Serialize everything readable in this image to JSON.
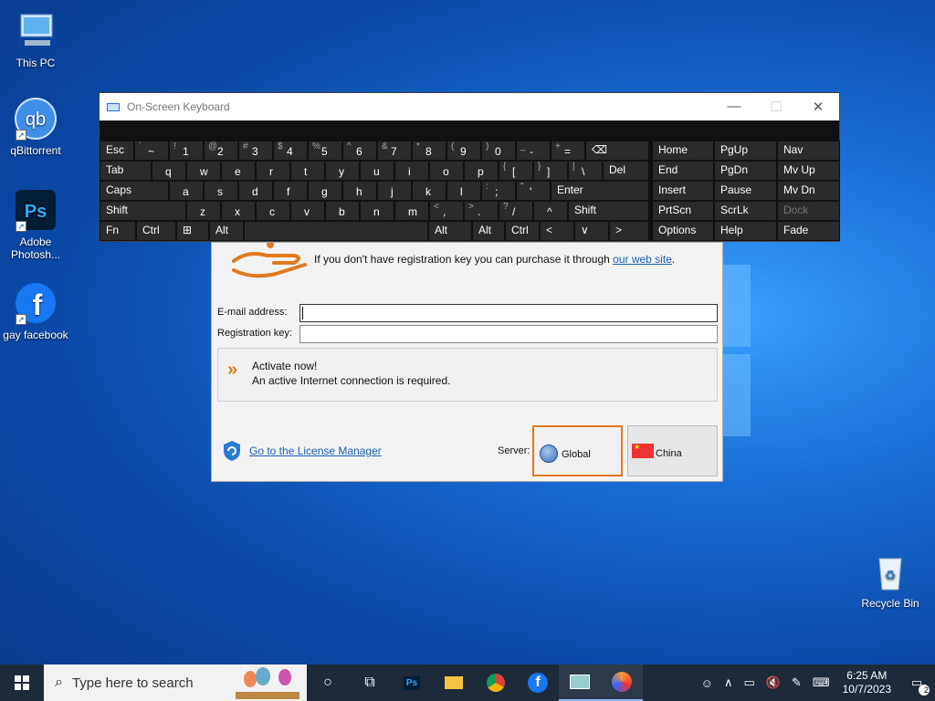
{
  "desktop": {
    "icons": [
      {
        "label": "This PC",
        "icon": "computer-icon"
      },
      {
        "label": "qBittorrent",
        "icon": "qbittorrent-icon"
      },
      {
        "label": "Adobe Photosh...",
        "icon": "photoshop-icon"
      },
      {
        "label": "gay facebook",
        "icon": "facebook-icon"
      },
      {
        "label": "Recycle Bin",
        "icon": "recycle-bin-icon"
      }
    ]
  },
  "osk": {
    "title": "On-Screen Keyboard",
    "controls": {
      "minimize": "—",
      "maximize": "☐",
      "close": "✕"
    },
    "row1": [
      "Esc",
      "~",
      "1",
      "2",
      "3",
      "4",
      "5",
      "6",
      "7",
      "8",
      "9",
      "0",
      "-",
      "=",
      "⌫"
    ],
    "row1_top": [
      "",
      "`",
      "!",
      "@",
      "#",
      "$",
      "%",
      "^",
      "&",
      "*",
      "(",
      ")",
      "_",
      "+",
      ""
    ],
    "row2": [
      "Tab",
      "q",
      "w",
      "e",
      "r",
      "t",
      "y",
      "u",
      "i",
      "o",
      "p",
      "[",
      "]",
      "\\",
      "Del"
    ],
    "row2_top": [
      "",
      "",
      "",
      "",
      "",
      "",
      "",
      "",
      "",
      "",
      "",
      "{",
      "}",
      "|",
      ""
    ],
    "row3": [
      "Caps",
      "a",
      "s",
      "d",
      "f",
      "g",
      "h",
      "j",
      "k",
      "l",
      ";",
      "'",
      "Enter"
    ],
    "row3_top": [
      "",
      "",
      "",
      "",
      "",
      "",
      "",
      "",
      "",
      "",
      ":",
      "\"",
      ""
    ],
    "row4": [
      "Shift",
      "z",
      "x",
      "c",
      "v",
      "b",
      "n",
      "m",
      ",",
      ".",
      "/",
      "^",
      "Shift"
    ],
    "row4_top": [
      "",
      "",
      "",
      "",
      "",
      "",
      "",
      "",
      "<",
      ">",
      "?",
      "",
      ""
    ],
    "row5": [
      "Fn",
      "Ctrl",
      "⊞",
      "Alt",
      "Alt",
      "Ctrl",
      "<",
      "∨",
      ">",
      "▤"
    ],
    "nav": [
      [
        "Home",
        "PgUp",
        "Nav"
      ],
      [
        "End",
        "PgDn",
        "Mv Up"
      ],
      [
        "Insert",
        "Pause",
        "Mv Dn"
      ],
      [
        "PrtScn",
        "ScrLk",
        "Dock"
      ],
      [
        "Options",
        "Help",
        "Fade"
      ]
    ]
  },
  "dialog": {
    "reg_text": "If you don't have registration key you can purchase it through ",
    "reg_link": "our web site",
    "reg_end": ".",
    "email_label": "E-mail address:",
    "email_value": "",
    "regkey_label": "Registration key:",
    "regkey_value": "",
    "activate_title": "Activate now!",
    "activate_sub": "An active Internet connection is required.",
    "license_link": "Go to the License Manager",
    "server_label": "Server:",
    "server_global": "Global",
    "server_china": "China",
    "accent": "#e07a20"
  },
  "taskbar": {
    "search_placeholder": "Type here to search",
    "time": "6:25 AM",
    "date": "10/7/2023",
    "notification_count": "2",
    "apps": [
      "cortana-icon",
      "task-view-icon",
      "photoshop-icon",
      "file-explorer-icon",
      "chrome-icon",
      "facebook-icon",
      "remote-desktop-icon",
      "media-player-icon"
    ]
  }
}
